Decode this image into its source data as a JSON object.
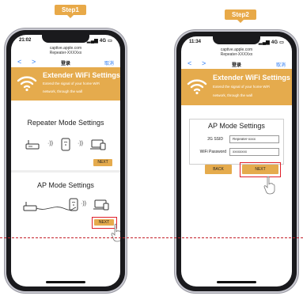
{
  "steps": {
    "step1_label": "Step1",
    "step2_label": "Step2"
  },
  "phone1": {
    "status": {
      "time": "21:02",
      "signal": "4G"
    },
    "url": {
      "host": "captive.apple.com",
      "ssid": "Repeater-XXXXxx"
    },
    "nav": {
      "back": "<",
      "forward": ">",
      "title": "登录",
      "cancel": "取消"
    },
    "banner": {
      "title": "Extender WiFi Settings",
      "line1": "Extend the signal of your home WiFi",
      "line2": "network, through the wall"
    },
    "repeater_section": {
      "title": "Repeater Mode Settings",
      "next": "NEXT"
    },
    "ap_section": {
      "title": "AP Mode Settings",
      "next": "NEXT"
    }
  },
  "phone2": {
    "status": {
      "time": "11:34",
      "signal": "4G"
    },
    "url": {
      "host": "captive.apple.com",
      "ssid": "Repeater-XXXXxx"
    },
    "nav": {
      "back": "<",
      "forward": ">",
      "title": "登录",
      "cancel": "取消"
    },
    "banner": {
      "title": "Extender WiFi Settings",
      "line1": "Extend the signal of your home WiFi",
      "line2": "network, through the wall"
    },
    "ap_form": {
      "title": "AP Mode Settings",
      "ssid_label": "2G SSID",
      "ssid_value": "Repeater-xxxx",
      "password_label": "WiFi Password",
      "password_value": "xxxxxxxx",
      "back": "BACK",
      "next": "NEXT"
    }
  },
  "colors": {
    "accent": "#e5ab4d",
    "highlight": "#e0202a",
    "link": "#2c7cf5"
  }
}
